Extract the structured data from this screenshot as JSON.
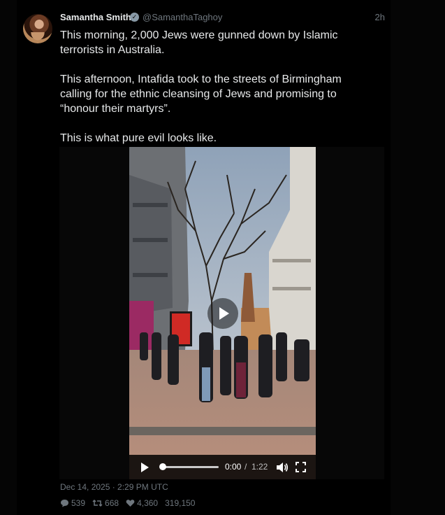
{
  "tweet": {
    "author_name": "Samantha Smith",
    "author_handle": "@SamanthaTaghoy",
    "relative_time": "2h",
    "paragraphs": [
      "This morning, 2,000 Jews were gunned down by Islamic terrorists in Australia.",
      "This afternoon, Intafida took to the streets of Birmingham calling for the ethnic cleansing of Jews and promising to “honour their martyrs”.",
      "This is what pure evil looks like."
    ],
    "date": "Dec 14, 2025 · 2:29 PM UTC",
    "stats": {
      "replies": "539",
      "retweets": "668",
      "likes": "4,360",
      "views": "319,150"
    }
  },
  "video": {
    "current_time": "0:00",
    "separator": "/",
    "duration": "1:22",
    "progress": 0.0
  },
  "icons": {
    "verified": "verified-badge-icon",
    "reply": "reply-icon",
    "retweet": "retweet-icon",
    "like": "like-icon",
    "play": "play-icon",
    "volume": "volume-icon",
    "fullscreen": "fullscreen-icon"
  },
  "colors": {
    "background": "#000000",
    "text": "#e7e9ea",
    "muted": "#6e767d"
  }
}
